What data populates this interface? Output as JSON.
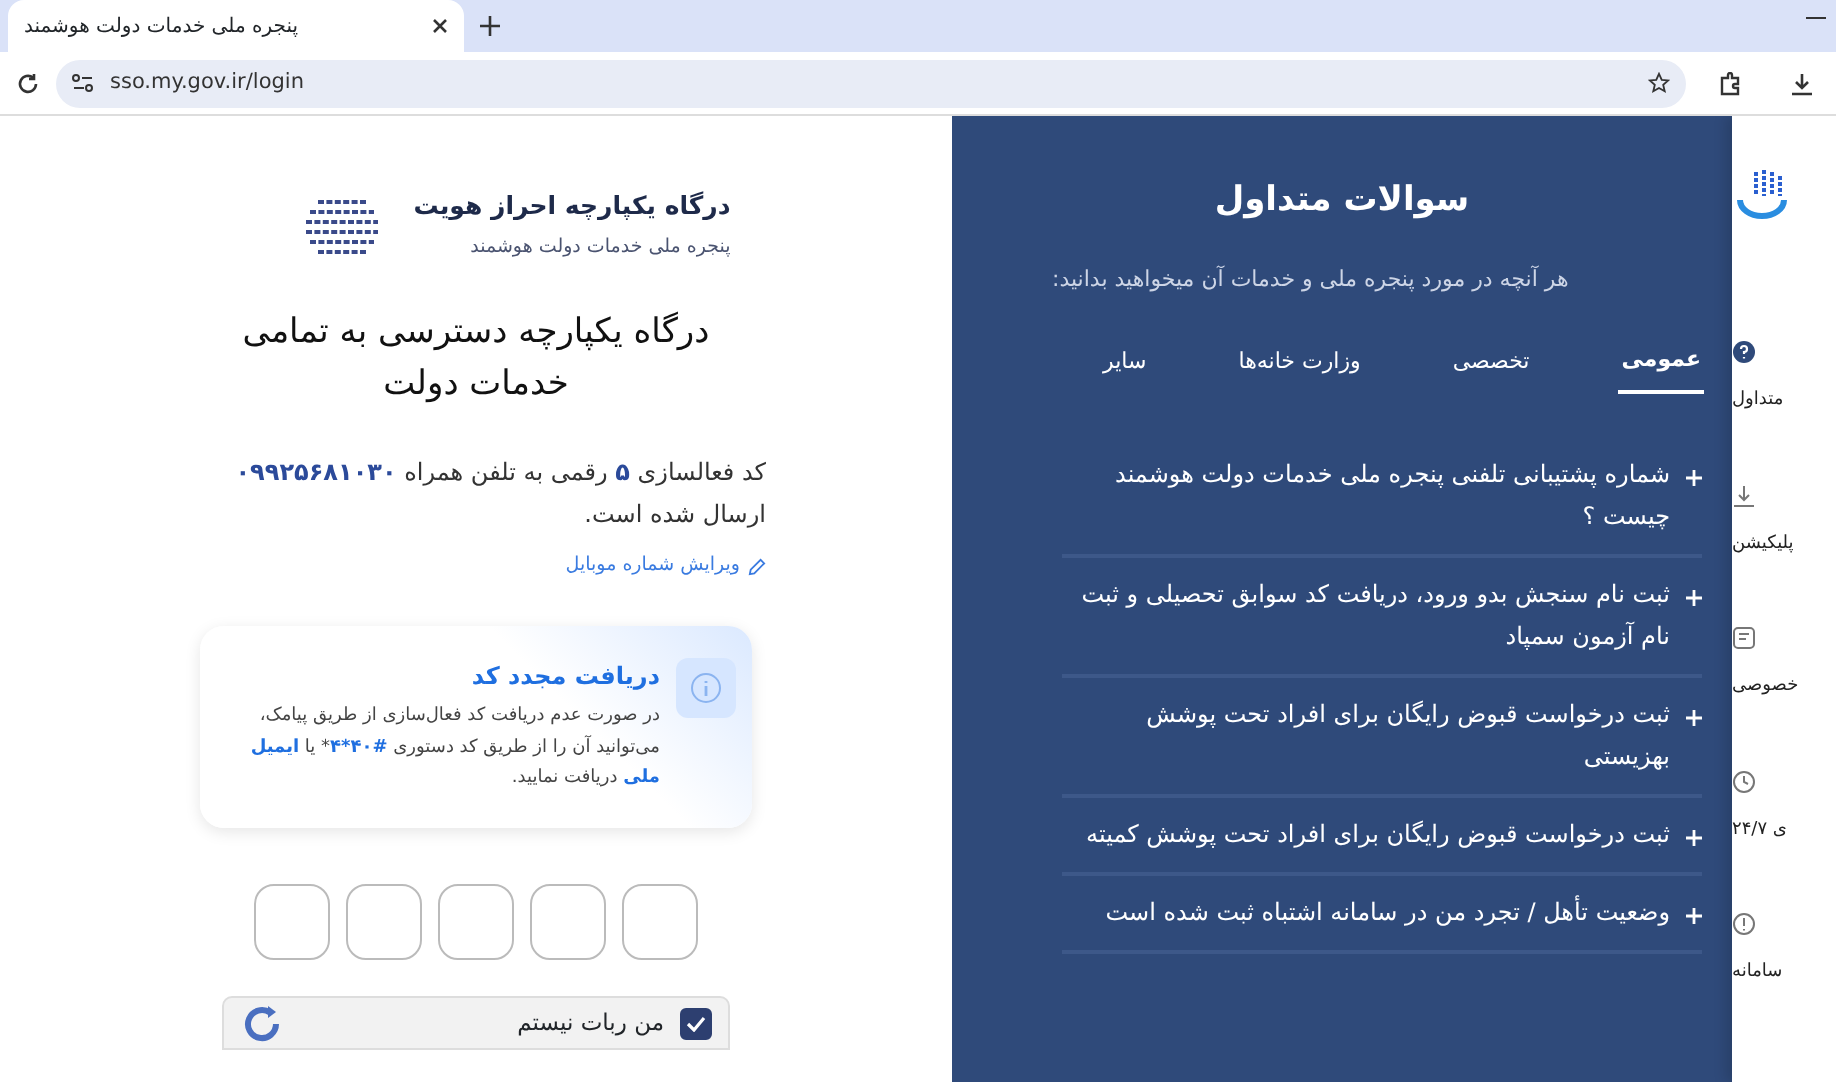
{
  "browser": {
    "tab_title": "پنجره ملی خدمات دولت هوشمند",
    "url": "sso.my.gov.ir/login"
  },
  "identity_header": {
    "title": "درگاه یکپارچه احراز هویت",
    "subtitle": "پنجره ملی خدمات دولت هوشمند"
  },
  "heading": "درگاه یکپارچه دسترسی به تمامی خدمات دولت",
  "activation_message": "کد فعالسازی **۵** رقمی به تلفن همراه **۰۹۹۲۵۶۸۱۰۳۰** ارسال شده است.",
  "edit_link": "ویرایش شماره موبایل",
  "resend_card": {
    "title": "دریافت مجدد کد",
    "body": "در صورت عدم دریافت کد فعال‌سازی از طریق پیامک، می‌توانید آن را از طریق کد دستوری **#۴۰*۴*** یا **ایمیل ملی** دریافت نمایید."
  },
  "otp_fields": [
    {
      "filled": false
    },
    {
      "filled": false
    },
    {
      "filled": false
    },
    {
      "filled": false
    },
    {
      "filled": false
    }
  ],
  "captcha": {
    "label": "من ربات نیستم",
    "checked": true
  },
  "faq": {
    "title": "سوالات متداول",
    "subtitle": "هر آنچه در مورد پنجره ملی و خدمات آن میخواهید بدانید:",
    "tabs": [
      {
        "label": "عمومی",
        "selected": true
      },
      {
        "label": "تخصصی",
        "selected": false
      },
      {
        "label": "وزارت خانه‌ها",
        "selected": false
      },
      {
        "label": "سایر",
        "selected": false
      }
    ],
    "questions": [
      "شماره پشتیبانی تلفنی پنجره ملی خدمات دولت هوشمند چیست ؟",
      "ثبت نام سنجش بدو ورود، دریافت کد سوابق تحصیلی و ثبت نام آزمون سمپاد",
      "ثبت درخواست قبوض رایگان برای افراد تحت پوشش بهزیستی",
      "ثبت درخواست قبوض رایگان برای افراد تحت پوشش کمیته",
      "وضعیت تأهل / تجرد من در سامانه اشتباه ثبت شده است"
    ]
  },
  "side_menu": [
    {
      "kind": "question",
      "label": "متداول"
    },
    {
      "kind": "download",
      "label": "پلیکیشن"
    },
    {
      "kind": "document",
      "label": "خصوصی"
    },
    {
      "kind": "clock",
      "label": "ی ۲۴/۷"
    },
    {
      "kind": "info",
      "label": "سامانه"
    }
  ]
}
